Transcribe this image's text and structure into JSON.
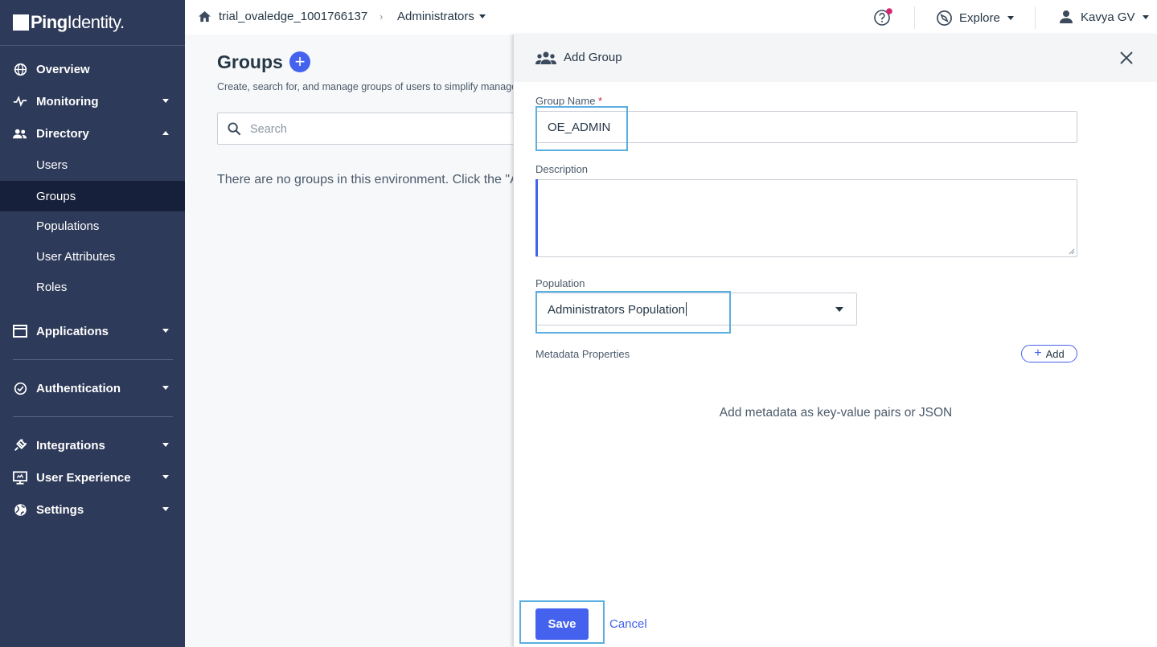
{
  "brand": {
    "logo_bold": "Ping",
    "logo_light": "Identity.",
    "logo_alt": "PingIdentity."
  },
  "sidebar": {
    "items": [
      {
        "label": "Overview",
        "icon": "globe-icon"
      },
      {
        "label": "Monitoring",
        "icon": "pulse-icon"
      },
      {
        "label": "Directory",
        "icon": "users-icon",
        "expanded": true
      },
      {
        "label": "Applications",
        "icon": "window-icon"
      },
      {
        "label": "Authentication",
        "icon": "check-circle-icon"
      },
      {
        "label": "Integrations",
        "icon": "plug-icon"
      },
      {
        "label": "User Experience",
        "icon": "monitor-icon"
      },
      {
        "label": "Settings",
        "icon": "globe-settings-icon"
      }
    ],
    "directory_sub": [
      "Users",
      "Groups",
      "Populations",
      "User Attributes",
      "Roles"
    ],
    "active_sub": "Groups"
  },
  "topbar": {
    "environment": "trial_ovaledge_1001766137",
    "context": "Administrators",
    "explore": "Explore",
    "user": "Kavya GV"
  },
  "main": {
    "title": "Groups",
    "description": "Create, search for, and manage groups of users to simplify management",
    "search_placeholder": "Search",
    "empty_message": "There are no groups in this environment. Click the \"Add\" button"
  },
  "panel": {
    "title": "Add Group",
    "group_name_label": "Group Name",
    "required_mark": "*",
    "group_name_value": "OE_ADMIN",
    "description_label": "Description",
    "description_value": "",
    "population_label": "Population",
    "population_value": "Administrators Population",
    "metadata_label": "Metadata Properties",
    "metadata_add": "Add",
    "metadata_empty": "Add metadata as key-value pairs or JSON",
    "save": "Save",
    "cancel": "Cancel"
  },
  "colors": {
    "sidebar": "#2e3a59",
    "accent": "#4462ed",
    "highlight": "#5aaee0",
    "notification": "#d6246e"
  }
}
